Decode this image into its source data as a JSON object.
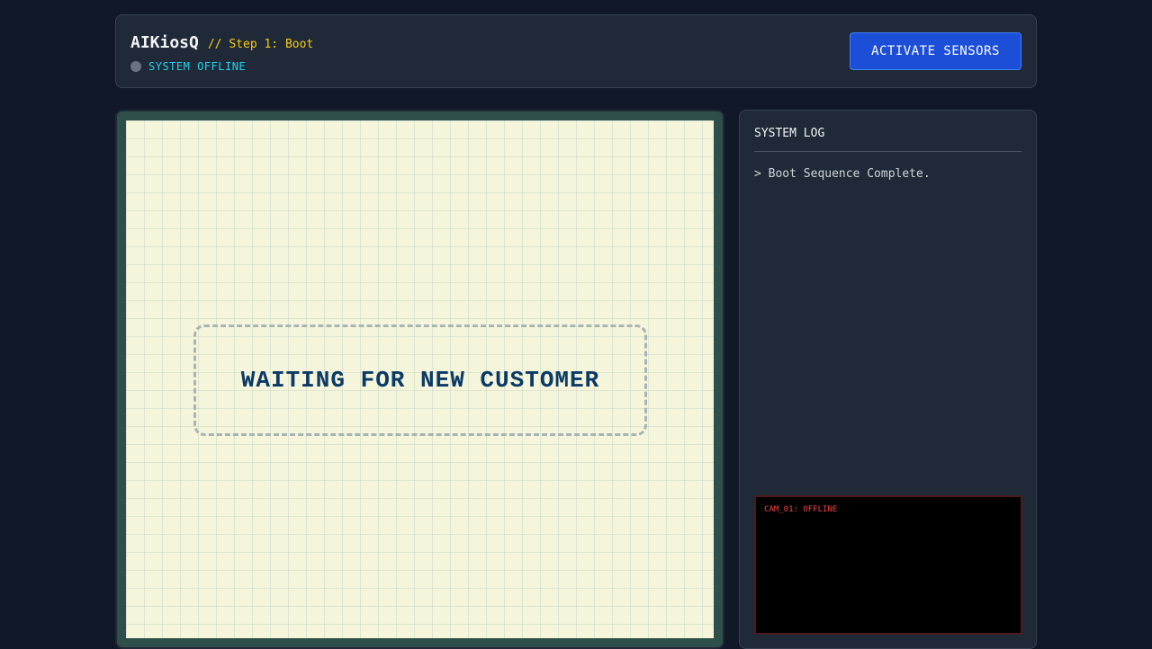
{
  "header": {
    "brand": "AIKiosQ",
    "step": "// Step 1: Boot",
    "status": "SYSTEM OFFLINE",
    "activate_label": "ACTIVATE SENSORS"
  },
  "screen": {
    "message": "WAITING FOR NEW CUSTOMER"
  },
  "log": {
    "title": "SYSTEM LOG",
    "entries": [
      "> Boot Sequence Complete."
    ]
  },
  "camera": {
    "label": "CAM_01: OFFLINE"
  },
  "colors": {
    "accent": "#1d4ed8",
    "status_text": "#22d3ee",
    "step_text": "#facc15",
    "camera_alert": "#ef4444",
    "screen_bg": "#f5f5dc"
  }
}
